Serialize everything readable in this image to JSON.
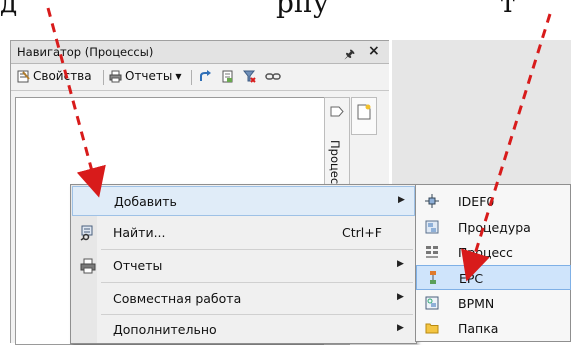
{
  "caption": {
    "part1": "д",
    "part2": "рпу",
    "part3": "т"
  },
  "navigator": {
    "title": "Навигатор (Процессы)",
    "toolbar": {
      "properties": "Свойства",
      "reports": "Отчеты"
    },
    "side_tab": "Процессы"
  },
  "context_menu": {
    "items": [
      {
        "label": "Добавить",
        "submenu": true,
        "icon": ""
      },
      {
        "label": "Найти...",
        "shortcut": "Ctrl+F",
        "icon": "find-icon"
      },
      {
        "label": "Отчеты",
        "submenu": true,
        "icon": "printer-icon"
      },
      {
        "label": "Совместная работа",
        "submenu": true,
        "icon": ""
      },
      {
        "label": "Дополнительно",
        "submenu": true,
        "icon": ""
      }
    ]
  },
  "submenu": {
    "items": [
      {
        "label": "IDEF0",
        "icon": "idef0-icon"
      },
      {
        "label": "Процедура",
        "icon": "procedure-icon"
      },
      {
        "label": "Процесс",
        "icon": "process-icon"
      },
      {
        "label": "EPC",
        "icon": "epc-icon",
        "selected": true
      },
      {
        "label": "BPMN",
        "icon": "bpmn-icon"
      },
      {
        "label": "Папка",
        "icon": "folder-icon"
      }
    ]
  },
  "colors": {
    "arrow": "#d81b1b",
    "highlight": "#cfe4fb"
  }
}
